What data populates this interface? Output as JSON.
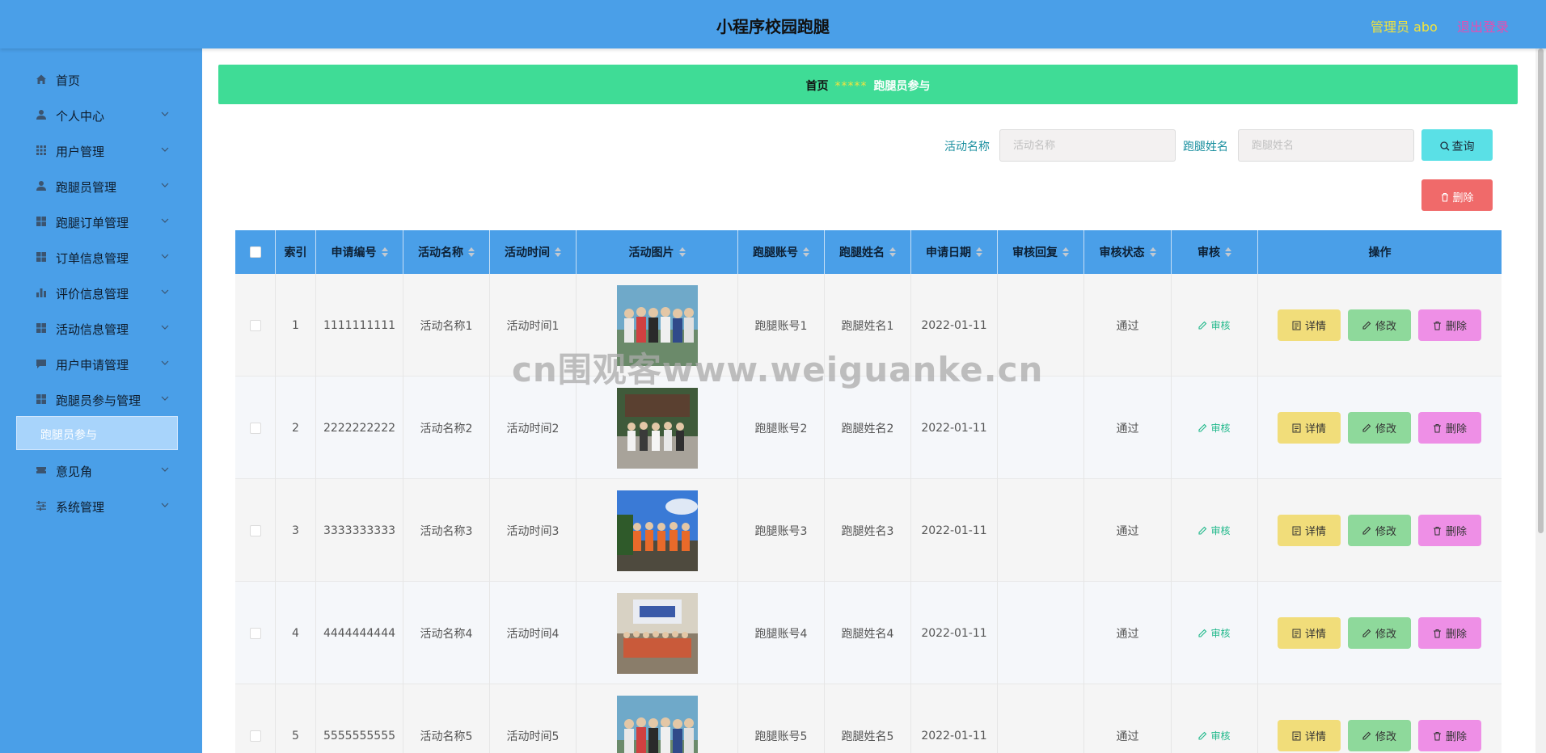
{
  "header": {
    "title": "小程序校园跑腿",
    "admin": "管理员 abo",
    "logout": "退出登录"
  },
  "sidebar": {
    "items": [
      {
        "label": "首页",
        "icon": "home-icon"
      },
      {
        "label": "个人中心",
        "icon": "user-icon"
      },
      {
        "label": "用户管理",
        "icon": "grid-icon"
      },
      {
        "label": "跑腿员管理",
        "icon": "user-icon"
      },
      {
        "label": "跑腿订单管理",
        "icon": "grid-icon"
      },
      {
        "label": "订单信息管理",
        "icon": "grid-icon"
      },
      {
        "label": "评价信息管理",
        "icon": "bar-chart-icon"
      },
      {
        "label": "活动信息管理",
        "icon": "grid-icon"
      },
      {
        "label": "用户申请管理",
        "icon": "message-icon"
      },
      {
        "label": "跑腿员参与管理",
        "icon": "grid-icon"
      },
      {
        "label": "意见角",
        "icon": "ticket-icon"
      },
      {
        "label": "系统管理",
        "icon": "sliders-icon"
      }
    ],
    "active_sub": "跑腿员参与"
  },
  "breadcrumb": {
    "home": "首页",
    "sep": "*****",
    "current": "跑腿员参与"
  },
  "search": {
    "activity_label": "活动名称",
    "activity_placeholder": "活动名称",
    "runner_label": "跑腿姓名",
    "runner_placeholder": "跑腿姓名",
    "query_button": "查询",
    "delete_button": "删除"
  },
  "table": {
    "columns": [
      "索引",
      "申请编号",
      "活动名称",
      "活动时间",
      "活动图片",
      "跑腿账号",
      "跑腿姓名",
      "申请日期",
      "审核回复",
      "审核状态",
      "审核",
      "操作"
    ],
    "rows": [
      {
        "index": "1",
        "apply_no": "1111111111",
        "activity": "活动名称1",
        "time": "活动时间1",
        "account": "跑腿账号1",
        "name": "跑腿姓名1",
        "date": "2022-01-11",
        "reply": "",
        "status": "通过",
        "audit": "审核"
      },
      {
        "index": "2",
        "apply_no": "2222222222",
        "activity": "活动名称2",
        "time": "活动时间2",
        "account": "跑腿账号2",
        "name": "跑腿姓名2",
        "date": "2022-01-11",
        "reply": "",
        "status": "通过",
        "audit": "审核"
      },
      {
        "index": "3",
        "apply_no": "3333333333",
        "activity": "活动名称3",
        "time": "活动时间3",
        "account": "跑腿账号3",
        "name": "跑腿姓名3",
        "date": "2022-01-11",
        "reply": "",
        "status": "通过",
        "audit": "审核"
      },
      {
        "index": "4",
        "apply_no": "4444444444",
        "activity": "活动名称4",
        "time": "活动时间4",
        "account": "跑腿账号4",
        "name": "跑腿姓名4",
        "date": "2022-01-11",
        "reply": "",
        "status": "通过",
        "audit": "审核"
      },
      {
        "index": "5",
        "apply_no": "5555555555",
        "activity": "活动名称5",
        "time": "活动时间5",
        "account": "跑腿账号5",
        "name": "跑腿姓名5",
        "date": "2022-01-11",
        "reply": "",
        "status": "通过",
        "audit": "审核"
      }
    ],
    "actions": {
      "detail": "详情",
      "edit": "修改",
      "delete": "删除"
    }
  },
  "watermark": "cn围观客www.weiguanke.cn"
}
